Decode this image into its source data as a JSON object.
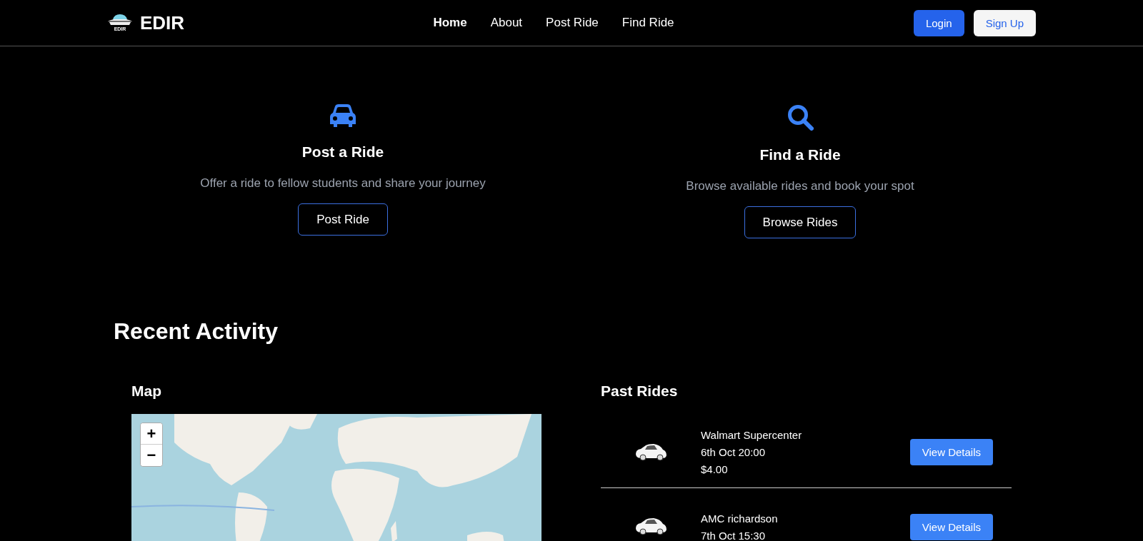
{
  "header": {
    "logo_caption": "EDIR",
    "brand": "EDIR",
    "nav": [
      {
        "label": "Home",
        "selected": true
      },
      {
        "label": "About",
        "selected": false
      },
      {
        "label": "Post Ride",
        "selected": false
      },
      {
        "label": "Find Ride",
        "selected": false
      }
    ],
    "buttons": [
      {
        "label": "Login",
        "kind": "primary"
      },
      {
        "label": "Sign Up",
        "kind": "light"
      }
    ]
  },
  "features": [
    {
      "kind": "car",
      "title": "Post a Ride",
      "description": "Offer a ride to fellow students and share your journey",
      "button": "Post Ride"
    },
    {
      "kind": "search",
      "title": "Find a Ride",
      "description": "Browse available rides and book your spot",
      "button": "Browse Rides"
    }
  ],
  "recent_activity": {
    "title": "Recent Activity",
    "map": {
      "title": "Map",
      "zoom_in": "+",
      "zoom_out": "−"
    },
    "past_rides": {
      "title": "Past Rides",
      "rides": [
        {
          "place": "Walmart Supercenter",
          "time": "6th Oct 20:00",
          "price": "$4.00",
          "button": "View Details"
        },
        {
          "place": "AMC richardson",
          "time": "7th Oct 15:30",
          "button": "View Details"
        }
      ]
    }
  }
}
